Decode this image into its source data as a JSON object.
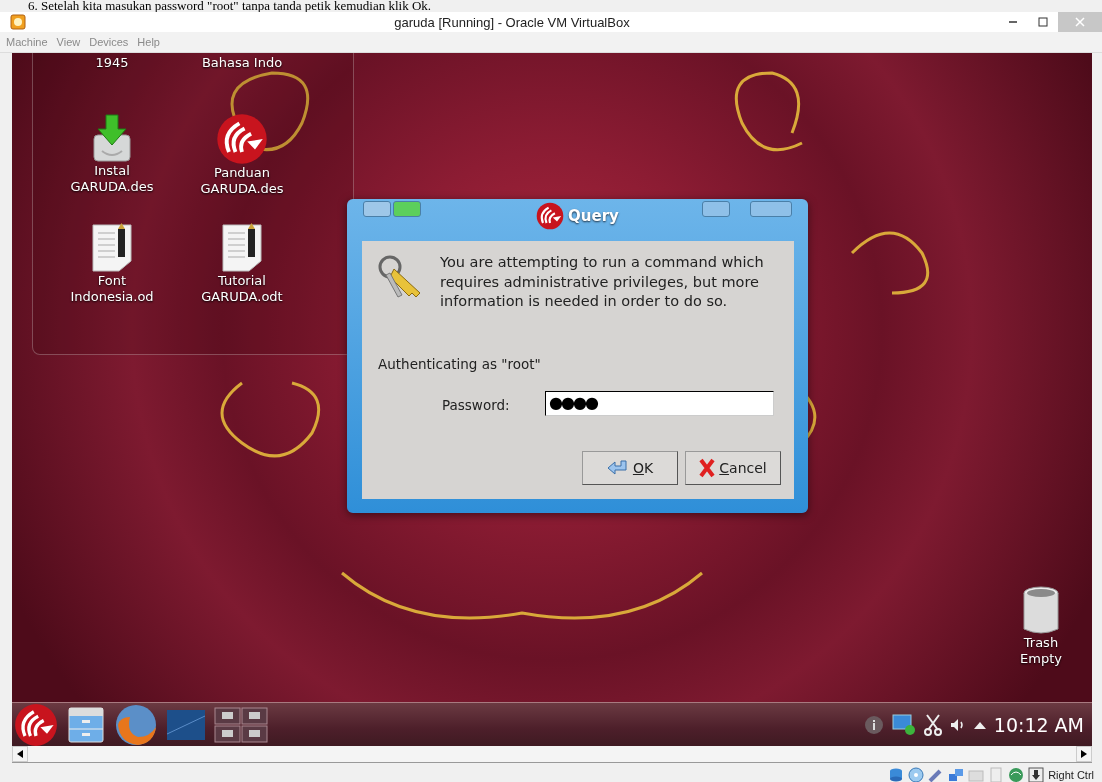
{
  "document_caption": "6.   Setelah kita masukan password \"root\" tanpa tanda petik kemudian klik Ok.",
  "window": {
    "title": "garuda [Running] - Oracle VM VirtualBox"
  },
  "menu": [
    "Machine",
    "View",
    "Devices",
    "Help"
  ],
  "desktop": {
    "icons": [
      {
        "kind": "partial",
        "lines": [
          "1945"
        ]
      },
      {
        "kind": "partial",
        "lines": [
          "Bahasa Indo"
        ]
      },
      {
        "kind": "installer",
        "lines": [
          "Instal",
          "GARUDA.des"
        ]
      },
      {
        "kind": "logo",
        "lines": [
          "Panduan",
          "GARUDA.des"
        ]
      },
      {
        "kind": "document",
        "lines": [
          "Font",
          "Indonesia.od"
        ]
      },
      {
        "kind": "document",
        "lines": [
          "Tutorial",
          "GARUDA.odt"
        ]
      }
    ],
    "trash": {
      "label": "Trash",
      "status": "Empty"
    }
  },
  "dialog": {
    "title": "Query",
    "message": "You are attempting to run a command which requires administrative privileges, but more information is needed in order to do so.",
    "auth": "Authenticating as \"root\"",
    "password_label": "Password:",
    "password_value": "●●●●",
    "buttons": [
      {
        "kind": "ok",
        "label": "OK"
      },
      {
        "kind": "cancel",
        "label": "Cancel"
      }
    ]
  },
  "taskbar": {
    "clock": "10:12 AM"
  },
  "status_bar": {
    "host_key": "Right Ctrl"
  }
}
